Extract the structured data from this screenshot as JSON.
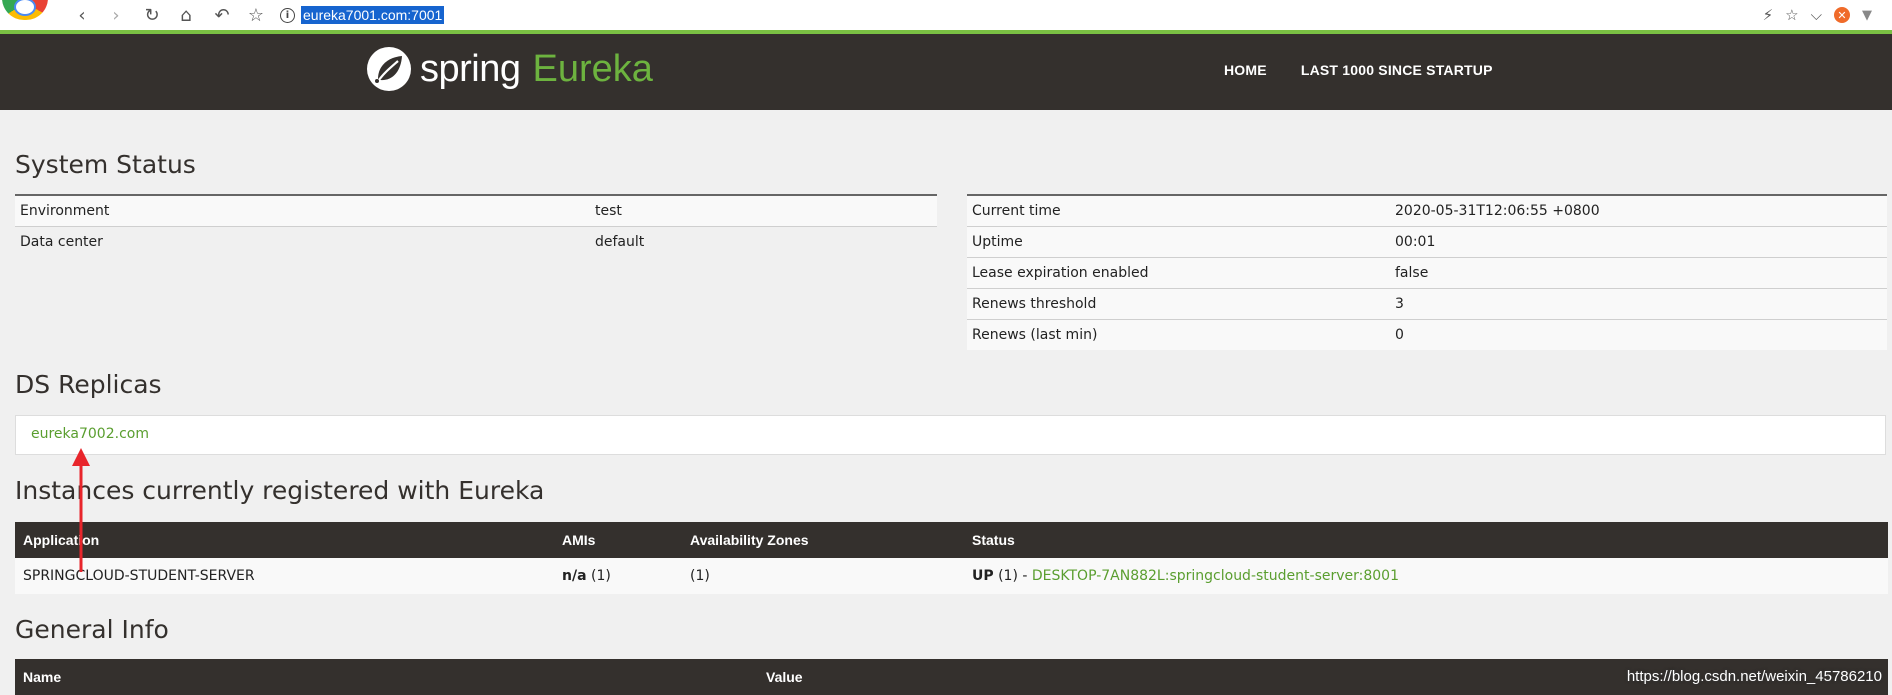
{
  "browser": {
    "url": "eureka7001.com:7001",
    "back_glyph": "‹",
    "forward_glyph": "›",
    "reload_glyph": "↻",
    "home_glyph": "⌂",
    "undo_glyph": "↶",
    "star_glyph": "☆",
    "info_glyph": "i",
    "right_icons": [
      "⚡",
      "☆",
      "⌵"
    ],
    "close_glyph": "✕",
    "menu_glyph": "▼"
  },
  "header": {
    "logo_word": "spring",
    "logo_product": "Eureka",
    "nav": [
      "HOME",
      "LAST 1000 SINCE STARTUP"
    ]
  },
  "system_status": {
    "title": "System Status",
    "left_rows": [
      {
        "key": "Environment",
        "value": "test"
      },
      {
        "key": "Data center",
        "value": "default"
      }
    ],
    "right_rows": [
      {
        "key": "Current time",
        "value": "2020-05-31T12:06:55 +0800"
      },
      {
        "key": "Uptime",
        "value": "00:01"
      },
      {
        "key": "Lease expiration enabled",
        "value": "false"
      },
      {
        "key": "Renews threshold",
        "value": "3"
      },
      {
        "key": "Renews (last min)",
        "value": "0"
      }
    ]
  },
  "ds_replicas": {
    "title": "DS Replicas",
    "replica": "eureka7002.com"
  },
  "instances": {
    "title": "Instances currently registered with Eureka",
    "columns": [
      "Application",
      "AMIs",
      "Availability Zones",
      "Status"
    ],
    "rows": [
      {
        "application": "SPRINGCLOUD-STUDENT-SERVER",
        "amis_bold": "n/a",
        "amis_count": "(1)",
        "zones": "(1)",
        "status_bold": "UP",
        "status_count": "(1) -",
        "instance_link": "DESKTOP-7AN882L:springcloud-student-server:8001"
      }
    ]
  },
  "general_info": {
    "title": "General Info",
    "columns": [
      "Name",
      "Value"
    ]
  },
  "watermark": "https://blog.csdn.net/weixin_45786210",
  "colors": {
    "header_bg": "#34302d",
    "brand_green": "#6db33f",
    "link_green": "#5a9e2f",
    "annotation_red": "#e8252b"
  }
}
